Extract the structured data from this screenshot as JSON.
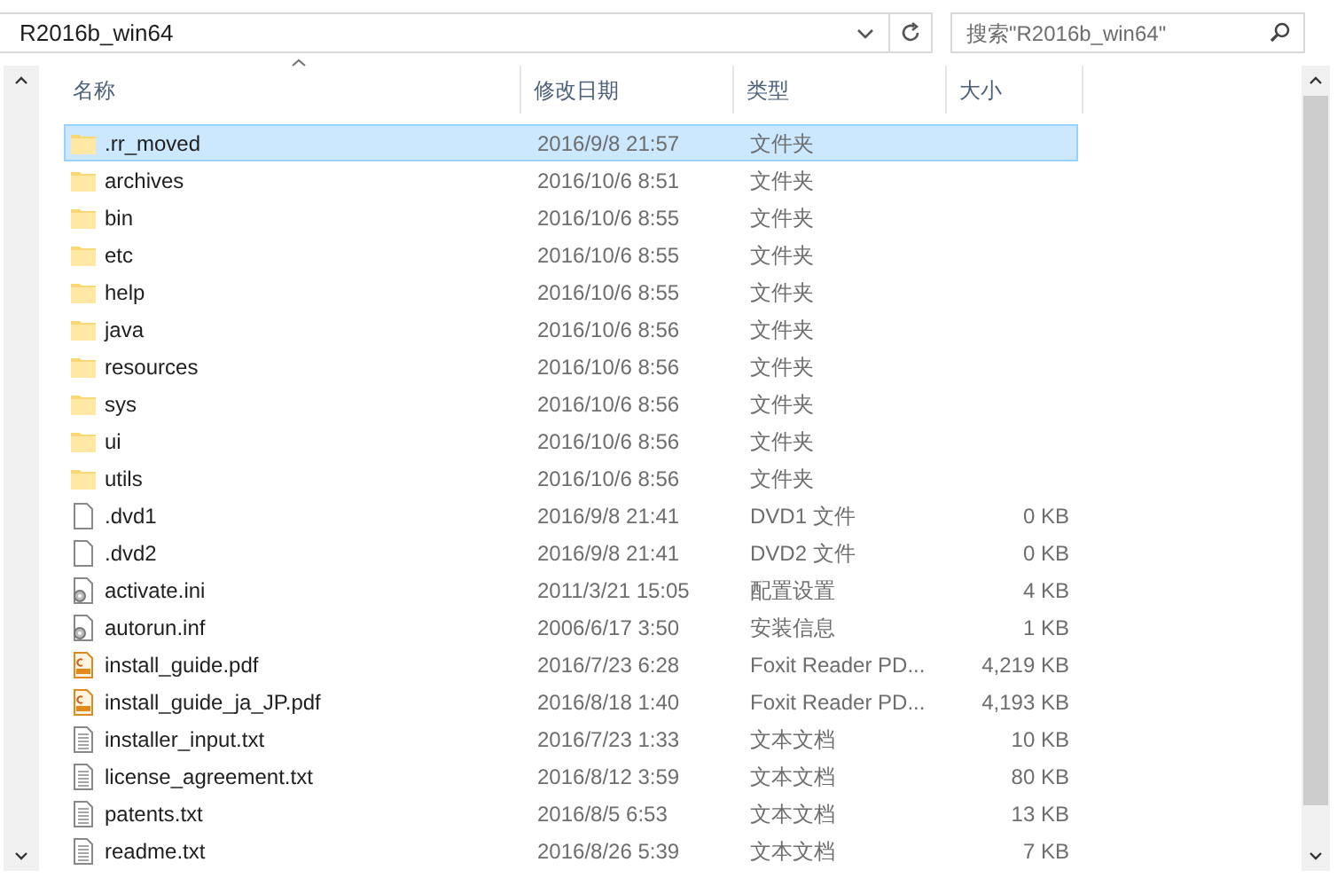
{
  "address_bar": {
    "path": "R2016b_win64"
  },
  "search": {
    "placeholder": "搜索\"R2016b_win64\""
  },
  "columns": [
    {
      "label": "名称",
      "sorted": true
    },
    {
      "label": "修改日期",
      "sorted": false
    },
    {
      "label": "类型",
      "sorted": false
    },
    {
      "label": "大小",
      "sorted": false
    }
  ],
  "rows": [
    {
      "kind": "folder",
      "name": ".rr_moved",
      "date": "2016/9/8 21:57",
      "type": "文件夹",
      "selected": true
    },
    {
      "kind": "folder",
      "name": "archives",
      "date": "2016/10/6 8:51",
      "type": "文件夹",
      "selected": false
    },
    {
      "kind": "folder",
      "name": "bin",
      "date": "2016/10/6 8:55",
      "type": "文件夹",
      "selected": false
    },
    {
      "kind": "folder",
      "name": "etc",
      "date": "2016/10/6 8:55",
      "type": "文件夹",
      "selected": false
    },
    {
      "kind": "folder",
      "name": "help",
      "date": "2016/10/6 8:55",
      "type": "文件夹",
      "selected": false
    },
    {
      "kind": "folder",
      "name": "java",
      "date": "2016/10/6 8:56",
      "type": "文件夹",
      "selected": false
    },
    {
      "kind": "folder",
      "name": "resources",
      "date": "2016/10/6 8:56",
      "type": "文件夹",
      "selected": false
    },
    {
      "kind": "folder",
      "name": "sys",
      "date": "2016/10/6 8:56",
      "type": "文件夹",
      "selected": false
    },
    {
      "kind": "folder",
      "name": "ui",
      "date": "2016/10/6 8:56",
      "type": "文件夹",
      "selected": false
    },
    {
      "kind": "folder",
      "name": "utils",
      "date": "2016/10/6 8:56",
      "type": "文件夹",
      "selected": false
    },
    {
      "kind": "file",
      "name": ".dvd1",
      "date": "2016/9/8 21:41",
      "type": "DVD1 文件",
      "size": "0 KB",
      "selected": false
    },
    {
      "kind": "file",
      "name": ".dvd2",
      "date": "2016/9/8 21:41",
      "type": "DVD2 文件",
      "size": "0 KB",
      "selected": false
    },
    {
      "kind": "config",
      "name": "activate.ini",
      "date": "2011/3/21 15:05",
      "type": "配置设置",
      "size": "4 KB",
      "selected": false
    },
    {
      "kind": "config",
      "name": "autorun.inf",
      "date": "2006/6/17 3:50",
      "type": "安装信息",
      "size": "1 KB",
      "selected": false
    },
    {
      "kind": "pdf",
      "name": "install_guide.pdf",
      "date": "2016/7/23 6:28",
      "type": "Foxit Reader PD...",
      "size": "4,219 KB",
      "selected": false
    },
    {
      "kind": "pdf",
      "name": "install_guide_ja_JP.pdf",
      "date": "2016/8/18 1:40",
      "type": "Foxit Reader PD...",
      "size": "4,193 KB",
      "selected": false
    },
    {
      "kind": "text",
      "name": "installer_input.txt",
      "date": "2016/7/23 1:33",
      "type": "文本文档",
      "size": "10 KB",
      "selected": false
    },
    {
      "kind": "text",
      "name": "license_agreement.txt",
      "date": "2016/8/12 3:59",
      "type": "文本文档",
      "size": "80 KB",
      "selected": false
    },
    {
      "kind": "text",
      "name": "patents.txt",
      "date": "2016/8/5 6:53",
      "type": "文本文档",
      "size": "13 KB",
      "selected": false
    },
    {
      "kind": "text",
      "name": "readme.txt",
      "date": "2016/8/26 5:39",
      "type": "文本文档",
      "size": "7 KB",
      "selected": false
    }
  ]
}
